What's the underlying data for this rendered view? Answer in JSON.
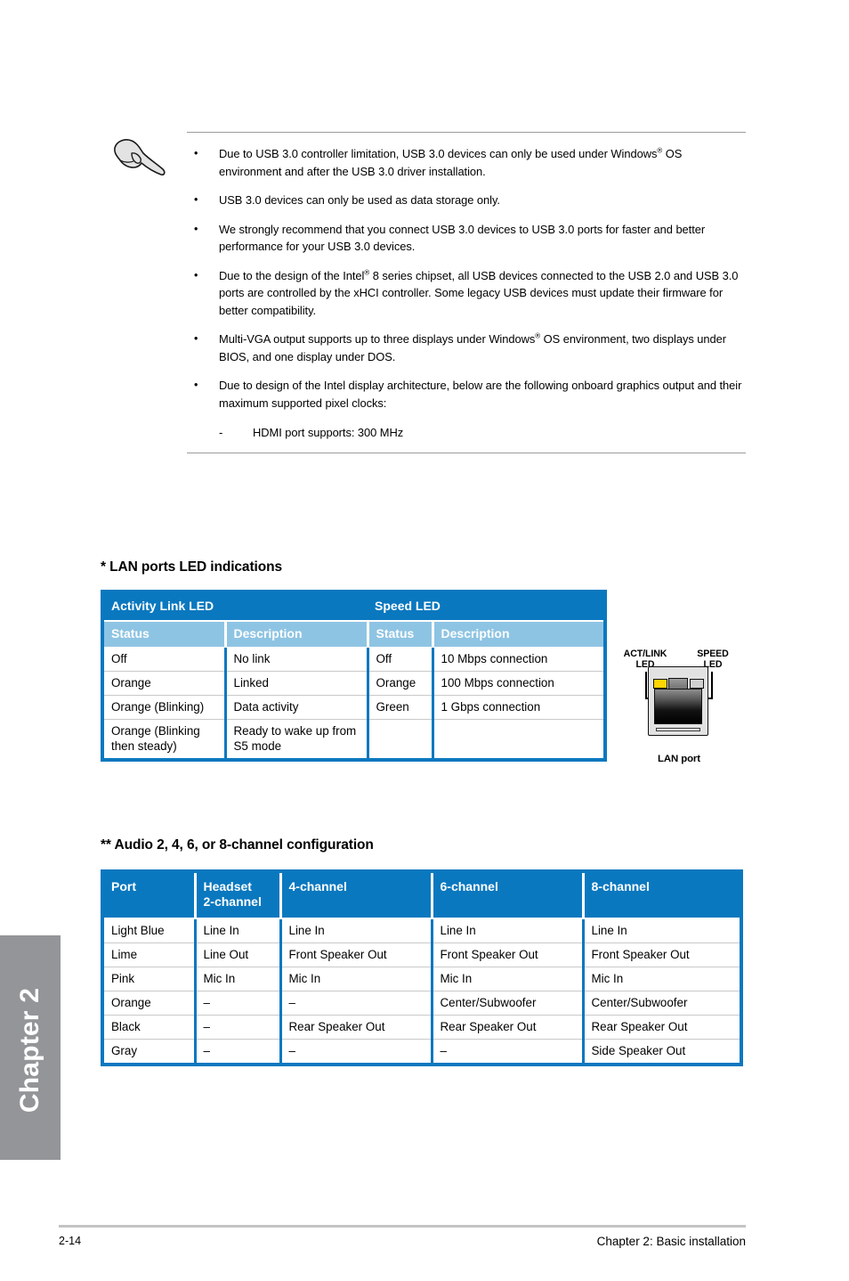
{
  "note": {
    "icon": "pointing-hand-icon",
    "bullet_char": "•",
    "dash_char": "-",
    "items": [
      {
        "pre": "Due to USB 3.0 controller limitation, USB 3.0 devices can only be used under Windows",
        "sup": "®",
        "post": " OS environment and after the USB 3.0 driver installation."
      },
      {
        "pre": "USB 3.0 devices can only be used as data storage only.",
        "sup": "",
        "post": ""
      },
      {
        "pre": "We strongly recommend that you connect USB 3.0 devices to USB 3.0 ports for faster and better performance for your USB 3.0 devices.",
        "sup": "",
        "post": ""
      },
      {
        "pre": "Due to the design of the Intel",
        "sup": "®",
        "post": " 8 series chipset, all USB devices connected to the USB 2.0 and USB 3.0 ports are controlled by the xHCI controller. Some legacy USB devices must update their firmware for better compatibility."
      },
      {
        "pre": "Multi-VGA output supports up to three displays under Windows",
        "sup": "®",
        "post": " OS environment, two displays under BIOS, and one display under DOS."
      },
      {
        "pre": "Due to design of the Intel display architecture, below are the following onboard graphics output and their maximum supported pixel clocks:",
        "sup": "",
        "post": ""
      }
    ],
    "sub_item": "HDMI port supports:  300 MHz"
  },
  "lan_section": {
    "heading": "* LAN ports LED indications",
    "table": {
      "group_headers": [
        "Activity Link LED",
        "Speed LED"
      ],
      "sub_headers": [
        "Status",
        "Description",
        "Status",
        "Description"
      ],
      "rows": [
        [
          "Off",
          "No link",
          "Off",
          "10 Mbps connection"
        ],
        [
          "Orange",
          "Linked",
          "Orange",
          "100 Mbps connection"
        ],
        [
          "Orange (Blinking)",
          "Data activity",
          "Green",
          "1 Gbps connection"
        ],
        [
          "Orange (Blinking then steady)",
          "Ready to wake up from S5 mode",
          "",
          ""
        ]
      ]
    },
    "figure": {
      "act_link_label": "ACT/LINK\nLED",
      "act_link_label_line1": "ACT/LINK",
      "act_link_label_line2": "LED",
      "speed_label_line1": "SPEED",
      "speed_label_line2": "LED",
      "caption": "LAN port",
      "act_led_color": "#ffd400",
      "speed_led_color": "#d0d0d0"
    }
  },
  "audio_section": {
    "heading": "** Audio 2, 4, 6, or 8-channel configuration",
    "table": {
      "headers": [
        "Port",
        "Headset\n2-channel",
        "4-channel",
        "6-channel",
        "8-channel"
      ],
      "header_port": "Port",
      "header_headset_l1": "Headset",
      "header_headset_l2": "2-channel",
      "header_4ch": "4-channel",
      "header_6ch": "6-channel",
      "header_8ch": "8-channel",
      "rows": [
        [
          "Light Blue",
          "Line In",
          "Line In",
          "Line In",
          "Line In"
        ],
        [
          "Lime",
          "Line Out",
          "Front Speaker Out",
          "Front Speaker Out",
          "Front Speaker Out"
        ],
        [
          "Pink",
          "Mic In",
          "Mic In",
          "Mic In",
          "Mic In"
        ],
        [
          "Orange",
          "–",
          "–",
          "Center/Subwoofer",
          "Center/Subwoofer"
        ],
        [
          "Black",
          "–",
          "Rear Speaker Out",
          "Rear Speaker Out",
          "Rear Speaker Out"
        ],
        [
          "Gray",
          "–",
          "–",
          "–",
          "Side Speaker Out"
        ]
      ]
    }
  },
  "chapter_tab": {
    "label": "Chapter 2",
    "color": "#939598"
  },
  "footer": {
    "page_number": "2-14",
    "chapter_title": "Chapter 2: Basic installation"
  },
  "colors": {
    "table_blue": "#0a78bf",
    "table_light_blue": "#8ec4e3",
    "rule_gray": "#9b9b9b",
    "footer_rule": "#c4c4c4"
  }
}
